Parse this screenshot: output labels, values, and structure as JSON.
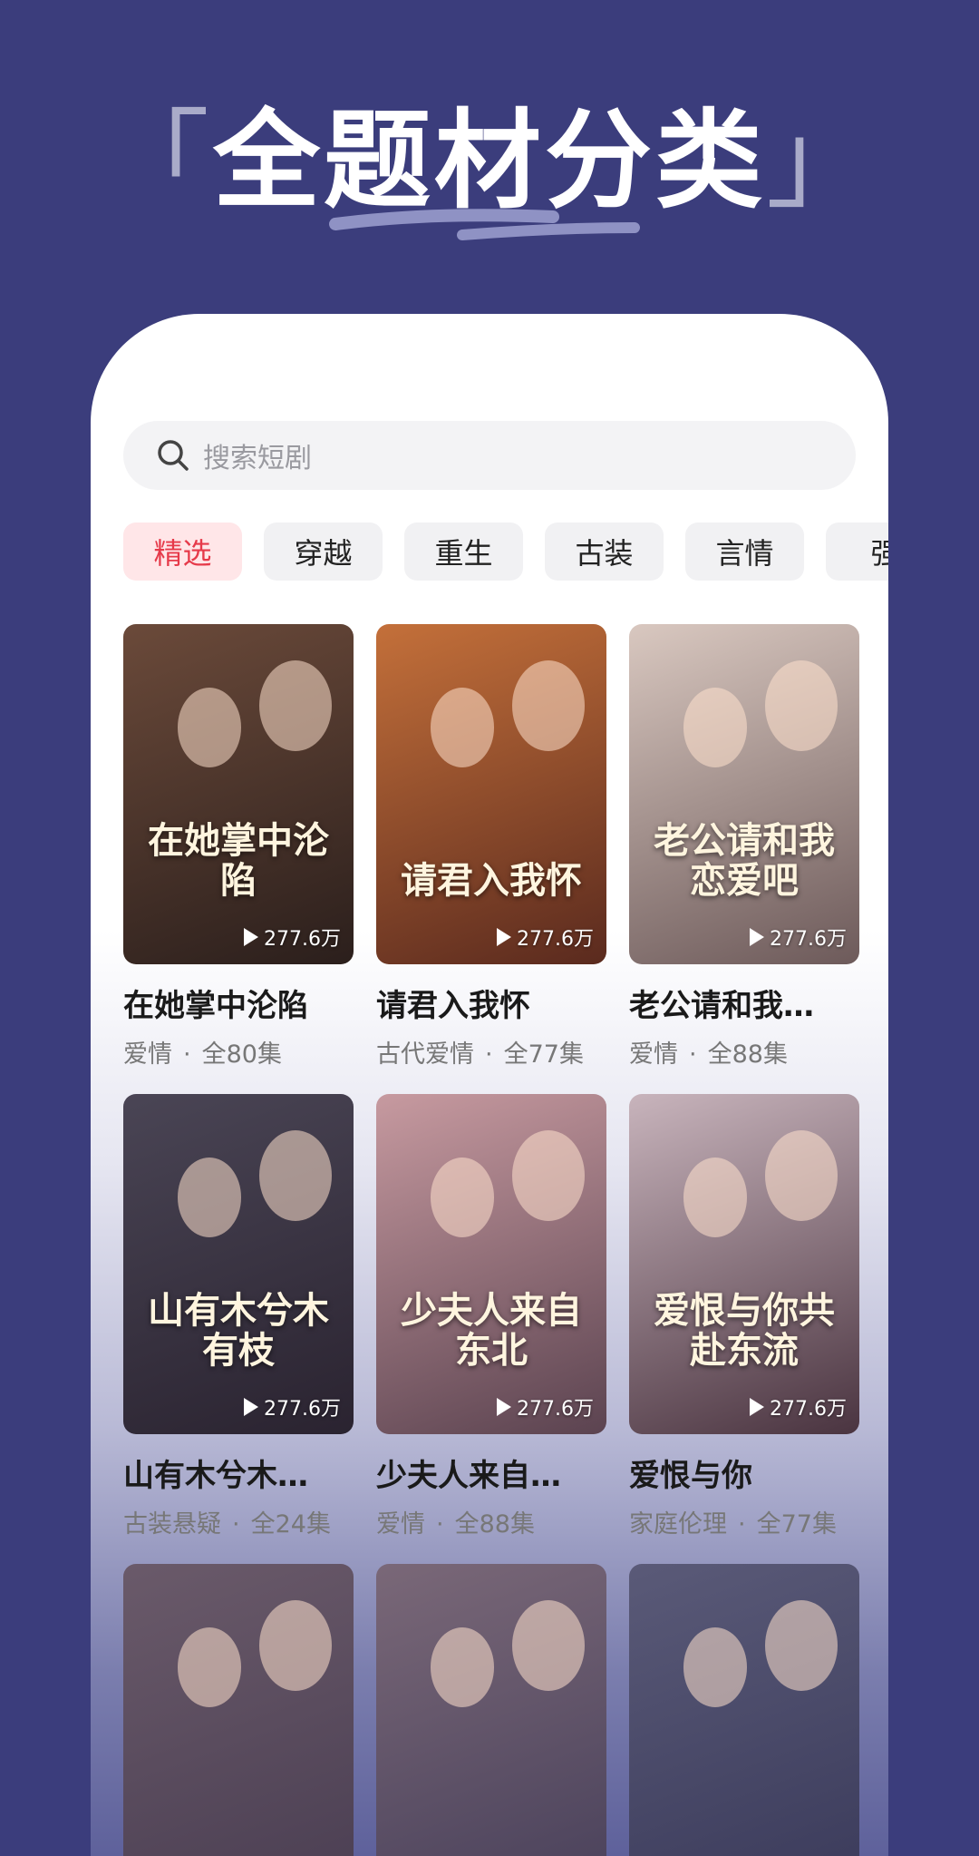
{
  "headline": {
    "open": "「",
    "text": "全题材分类",
    "close": "」"
  },
  "search": {
    "placeholder": "搜索短剧",
    "icon": "search-icon"
  },
  "categories": [
    {
      "label": "精选",
      "active": true
    },
    {
      "label": "穿越"
    },
    {
      "label": "重生"
    },
    {
      "label": "古装"
    },
    {
      "label": "言情"
    },
    {
      "label": "强"
    }
  ],
  "dramas": [
    {
      "title": "在她掌中沦陷",
      "poster_title": "在她掌中沦陷",
      "plays": "277.6万",
      "genre": "爱情",
      "episodes": "全80集",
      "colors": [
        "#6b4a3a",
        "#2b1f1c"
      ]
    },
    {
      "title": "请君入我怀",
      "poster_title": "请君入我怀",
      "plays": "277.6万",
      "genre": "古代爱情",
      "episodes": "全77集",
      "colors": [
        "#c4703a",
        "#5a2a1e"
      ]
    },
    {
      "title": "老公请和我…",
      "poster_title": "老公请和我恋爱吧",
      "plays": "277.6万",
      "genre": "爱情",
      "episodes": "全88集",
      "colors": [
        "#d9c8c0",
        "#6d5a5a"
      ]
    },
    {
      "title": "山有木兮木…",
      "poster_title": "山有木兮木有枝",
      "plays": "277.6万",
      "genre": "古装悬疑",
      "episodes": "全24集",
      "colors": [
        "#4a4555",
        "#2a2330"
      ]
    },
    {
      "title": "少夫人来自…",
      "poster_title": "少夫人来自东北",
      "plays": "277.6万",
      "genre": "爱情",
      "episodes": "全88集",
      "colors": [
        "#c79aa0",
        "#5b4350"
      ]
    },
    {
      "title": "爱恨与你",
      "poster_title": "爱恨与你共赴东流",
      "plays": "277.6万",
      "genre": "家庭伦理",
      "episodes": "全77集",
      "colors": [
        "#c8b4bc",
        "#4a3440"
      ]
    },
    {
      "title": "",
      "poster_title": "",
      "plays": "",
      "genre": "",
      "episodes": "",
      "colors": [
        "#6a5a6a",
        "#4a3e52"
      ]
    },
    {
      "title": "",
      "poster_title": "",
      "plays": "",
      "genre": "",
      "episodes": "",
      "colors": [
        "#7a6878",
        "#48405a"
      ]
    },
    {
      "title": "",
      "poster_title": "",
      "plays": "",
      "genre": "",
      "episodes": "",
      "colors": [
        "#5a5a78",
        "#3a3a5a"
      ]
    }
  ],
  "meta_separator": "·"
}
